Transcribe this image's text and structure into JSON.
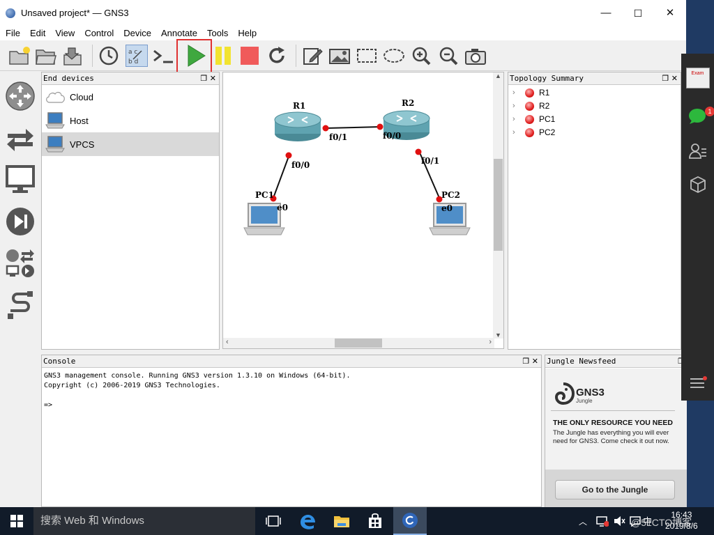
{
  "window": {
    "title": "Unsaved project* — GNS3",
    "minimize": "—",
    "maximize": "☐",
    "close": "✕"
  },
  "menu": [
    "File",
    "Edit",
    "View",
    "Control",
    "Device",
    "Annotate",
    "Tools",
    "Help"
  ],
  "toolbar": {
    "buttons": [
      "new-project",
      "open-project",
      "save-project",
      "snapshot",
      "show-interface-labels",
      "console-all",
      "start-all",
      "suspend-all",
      "stop-all",
      "reload-all",
      "add-note",
      "insert-image",
      "draw-rectangle",
      "draw-ellipse",
      "zoom-in",
      "zoom-out",
      "screenshot"
    ],
    "colors": {
      "start": "#3fa83f",
      "suspend": "#f2e330",
      "stop": "#f05a5a",
      "highlight": "#e03131"
    }
  },
  "end_devices": {
    "title": "End devices",
    "items": [
      {
        "label": "Cloud",
        "icon": "cloud-icon",
        "selected": false
      },
      {
        "label": "Host",
        "icon": "host-icon",
        "selected": false
      },
      {
        "label": "VPCS",
        "icon": "vpcs-icon",
        "selected": true
      }
    ]
  },
  "topology": {
    "nodes": {
      "r1": "R1",
      "r2": "R2",
      "pc1": "PC1",
      "pc2": "PC2"
    },
    "ports": {
      "r1_f01": "f0/1",
      "r1_f00": "f0/0",
      "r2_f00": "f0/0",
      "r2_f01": "f0/1",
      "pc1_e0": "e0",
      "pc2_e0": "e0"
    }
  },
  "topology_summary": {
    "title": "Topology Summary",
    "items": [
      "R1",
      "R2",
      "PC1",
      "PC2"
    ],
    "status_color": "#e02020"
  },
  "console": {
    "title": "Console",
    "lines": [
      "GNS3 management console. Running GNS3 version 1.3.10 on Windows (64-bit).",
      "Copyright (c) 2006-2019 GNS3 Technologies.",
      "",
      "=>"
    ]
  },
  "newsfeed": {
    "title": "Jungle Newsfeed",
    "logo": "GNS3",
    "logo_sub": "Jungle",
    "headline": "THE ONLY RESOURCE YOU NEED",
    "body": "The Jungle has everything you will ever need for GNS3. Come check it out now.",
    "button": "Go to the Jungle"
  },
  "side_panel": {
    "badge": "1",
    "thumb_text": "Exam"
  },
  "taskbar": {
    "search_placeholder": "搜索 Web 和 Windows",
    "time": "16:43",
    "date": "2019/8/6",
    "ime": "中",
    "watermark": "@51CTO博客"
  }
}
